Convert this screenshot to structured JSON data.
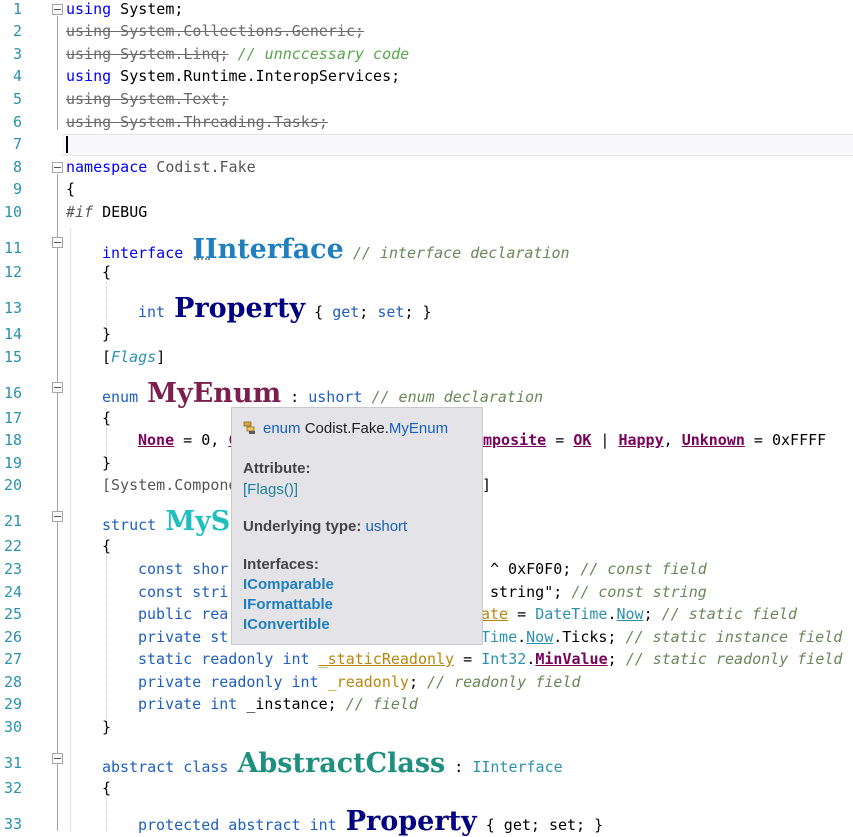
{
  "line_numbers": [
    "1",
    "2",
    "3",
    "4",
    "5",
    "6",
    "7",
    "8",
    "9",
    "10",
    "11",
    "12",
    "13",
    "14",
    "15",
    "16",
    "17",
    "18",
    "19",
    "20",
    "21",
    "22",
    "23",
    "24",
    "25",
    "26",
    "27",
    "28",
    "29",
    "30",
    "31",
    "32",
    "33"
  ],
  "code": {
    "l1_kw": "using",
    "l1_rest": " System;",
    "l2": "using System.Collections.Generic;",
    "l3_strike": "using System.Linq;",
    "l3_comment": " // unnccessary code",
    "l4_kw": "using",
    "l4_rest": " System.Runtime.InteropServices;",
    "l5": "using System.Text;",
    "l6": "using System.Threading.Tasks;",
    "l8_kw": "namespace",
    "l8_rest": " Codist.Fake",
    "l9": "{",
    "l10_kw": "#if",
    "l10_rest": " DEBUG",
    "l11_kw": "interface",
    "l11_name": "IInterface",
    "l11_comment": " // interface declaration",
    "l12": "{",
    "l13_kw": "int",
    "l13_name": "Property",
    "l13_open": " { ",
    "l13_get": "get",
    "l13_semi1": "; ",
    "l13_set": "set",
    "l13_close": "; }",
    "l14": "}",
    "l15_open": "[",
    "l15_attr": "Flags",
    "l15_close": "]",
    "l16_kw": "enum",
    "l16_name": "MyEnum",
    "l16_colon": " : ",
    "l16_type": "ushort",
    "l16_comment": " // enum declaration",
    "l17": "{",
    "l18_none": "None",
    "l18_mid": " = 0, ",
    "l18_c": "C",
    "l18_posite": "mposite",
    "l18_eq": " = ",
    "l18_ok": "OK",
    "l18_pipe": " | ",
    "l18_happy": "Happy",
    "l18_comma": ", ",
    "l18_unknown": "Unknown",
    "l18_end": " = 0xFFFF",
    "l19": "}",
    "l20_start": "[System.Compone",
    "l20_end": "]",
    "l21_kw": "struct",
    "l21_name": "MySt",
    "l22": "{",
    "l23_a": "const shor",
    "l23_b": "^ 0xF0F0; ",
    "l23_c": "// const field",
    "l24_a": "const stri",
    "l24_b": " string\"; ",
    "l24_c": "// const string",
    "l25_a": "public rea",
    "l25_b": "ate",
    "l25_c": " = ",
    "l25_d": "DateTime",
    "l25_e": ".",
    "l25_f": "Now",
    "l25_g": "; ",
    "l25_h": "// static field",
    "l26_a": "private st",
    "l26_b": "Time",
    "l26_c": ".",
    "l26_d": "Now",
    "l26_e": ".Ticks; ",
    "l26_f": "// static instance field",
    "l27_a": "static readonly int ",
    "l27_b": "_staticReadonly",
    "l27_c": " = ",
    "l27_d": "Int32",
    "l27_e": ".",
    "l27_f": "MinValue",
    "l27_g": "; ",
    "l27_h": "// static readonly field",
    "l28_a": "private readonly int ",
    "l28_b": "_readonly",
    "l28_c": "; ",
    "l28_d": "// readonly field",
    "l29_a": "private int ",
    "l29_b": "_instance",
    "l29_c": "; ",
    "l29_d": "// field",
    "l30": "}",
    "l31_kw": "abstract class",
    "l31_name": "AbstractClass",
    "l31_colon": " : ",
    "l31_base": "IInterface",
    "l32": "{",
    "l33_kw": "protected abstract int",
    "l33_name": "Property",
    "l33_rest": " { get; set; }"
  },
  "tooltip": {
    "title_kw": "enum",
    "title_ns": " Codist.Fake.",
    "title_name": "MyEnum",
    "attribute_label": "Attribute:",
    "attribute_value": "[Flags()]",
    "underlying_label": "Underlying type:",
    "underlying_value": "ushort",
    "interfaces_label": "Interfaces:",
    "interfaces": [
      "IComparable",
      "IFormattable",
      "IConvertible"
    ]
  }
}
